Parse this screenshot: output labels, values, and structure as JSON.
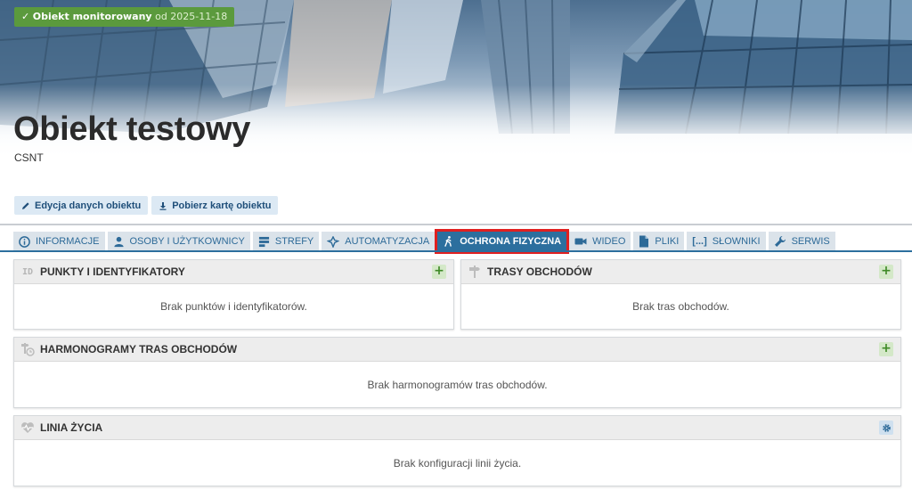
{
  "status": {
    "label": "Obiekt monitorowany",
    "since": "od 2025-11-18",
    "color": "#5b9a3d"
  },
  "object": {
    "title": "Obiekt testowy",
    "subtitle": "CSNT"
  },
  "actions": [
    {
      "label": "Edycja danych obiektu",
      "icon": "pencil-icon"
    },
    {
      "label": "Pobierz kartę obiektu",
      "icon": "download-icon"
    }
  ],
  "tabs": [
    {
      "label": "INFORMACJE",
      "icon": "info-icon"
    },
    {
      "label": "OSOBY I UŻYTKOWNICY",
      "icon": "user-icon"
    },
    {
      "label": "STREFY",
      "icon": "zones-icon"
    },
    {
      "label": "AUTOMATYZACJA",
      "icon": "automation-icon"
    },
    {
      "label": "OCHRONA FIZYCZNA",
      "icon": "walking-person-icon",
      "active": true
    },
    {
      "label": "WIDEO",
      "icon": "video-camera-icon"
    },
    {
      "label": "PLIKI",
      "icon": "file-icon"
    },
    {
      "label": "SŁOWNIKI",
      "icon": "dictionary-brackets-icon"
    },
    {
      "label": "SERWIS",
      "icon": "wrench-icon"
    }
  ],
  "panels": {
    "points": {
      "title": "PUNKTY I IDENTYFIKATORY",
      "icon_text": "ID",
      "empty": "Brak punktów i identyfikatorów.",
      "action": "+"
    },
    "routes": {
      "title": "TRASY OBCHODÓW",
      "icon": "signpost-icon",
      "empty": "Brak tras obchodów.",
      "action": "+"
    },
    "schedules": {
      "title": "HARMONOGRAMY TRAS OBCHODÓW",
      "icon": "schedule-clock-icon",
      "empty": "Brak harmonogramów tras obchodów.",
      "action": "+"
    },
    "lifeline": {
      "title": "LINIA ŻYCIA",
      "icon": "heartbeat-icon",
      "empty": "Brak konfiguracji linii życia.",
      "action_icon": "gear-icon"
    }
  },
  "colors": {
    "accent": "#2c6f9e",
    "tab_bg": "#dbe3ea",
    "active_outline": "#e02020",
    "add_btn": "#d4e8c8"
  }
}
